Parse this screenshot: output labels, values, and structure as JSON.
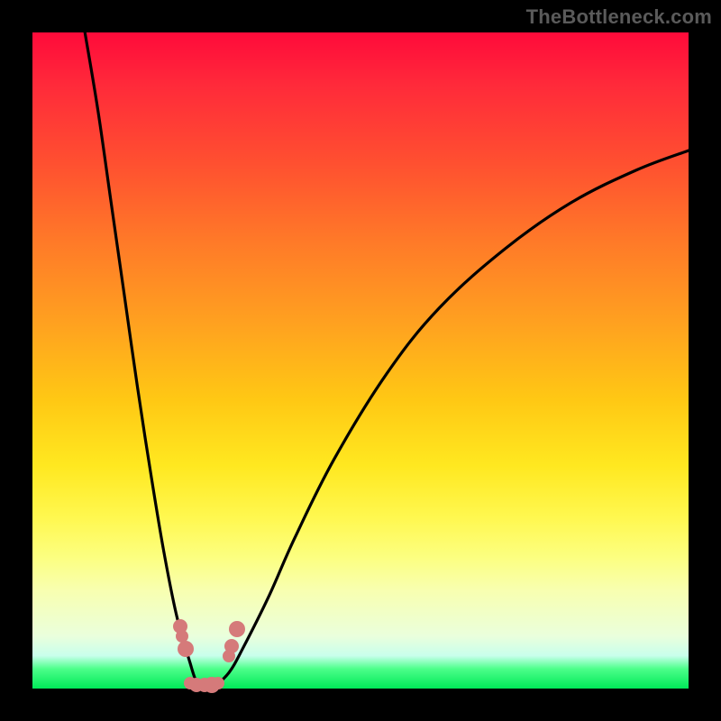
{
  "watermark": "TheBottleneck.com",
  "colors": {
    "frame": "#000000",
    "curve": "#000000",
    "marker": "#d57a7a"
  },
  "chart_data": {
    "type": "line",
    "title": "",
    "xlabel": "",
    "ylabel": "",
    "xlim": [
      0,
      100
    ],
    "ylim": [
      0,
      100
    ],
    "note": "Two V-shaped curves meeting near bottom; y-axis implies bottleneck percentage (low=green/good, high=red/bad). Values estimated from pixel positions; no axis ticks shown.",
    "series": [
      {
        "name": "left-branch",
        "x": [
          8,
          10,
          12,
          14,
          16,
          18,
          20,
          22,
          24,
          25,
          26,
          27
        ],
        "y": [
          100,
          88,
          74,
          60,
          46,
          33,
          21,
          11,
          4,
          1,
          0,
          0
        ]
      },
      {
        "name": "right-branch",
        "x": [
          27,
          28,
          30,
          32,
          36,
          40,
          46,
          54,
          62,
          72,
          82,
          92,
          100
        ],
        "y": [
          0,
          0.5,
          2.5,
          6,
          14,
          23,
          35,
          48,
          58,
          67,
          74,
          79,
          82
        ]
      }
    ],
    "markers": [
      {
        "x": 22.5,
        "y": 9.5,
        "r": 8
      },
      {
        "x": 22.8,
        "y": 8.0,
        "r": 7
      },
      {
        "x": 23.3,
        "y": 6.0,
        "r": 9
      },
      {
        "x": 24.0,
        "y": 0.8,
        "r": 7
      },
      {
        "x": 25.0,
        "y": 0.5,
        "r": 8
      },
      {
        "x": 26.2,
        "y": 0.5,
        "r": 8
      },
      {
        "x": 27.3,
        "y": 0.6,
        "r": 9
      },
      {
        "x": 28.3,
        "y": 0.8,
        "r": 7
      },
      {
        "x": 30.0,
        "y": 5.0,
        "r": 7
      },
      {
        "x": 30.4,
        "y": 6.4,
        "r": 8
      },
      {
        "x": 31.2,
        "y": 9.0,
        "r": 9
      }
    ]
  }
}
